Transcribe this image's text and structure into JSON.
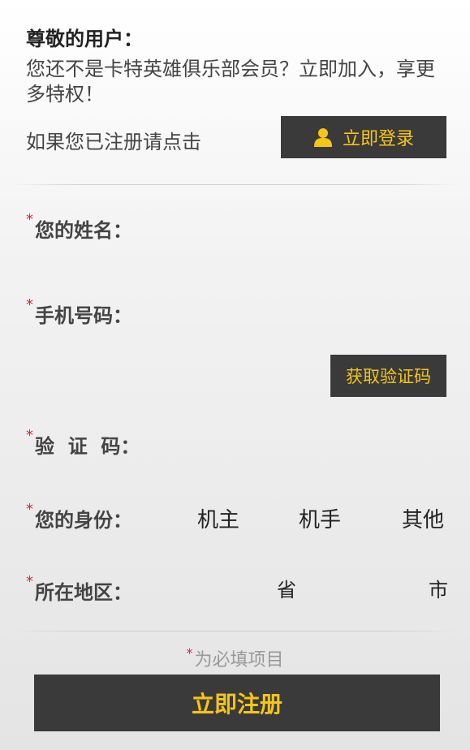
{
  "header": {
    "greeting": "尊敬的用户：",
    "intro": "您还不是卡特英雄俱乐部会员？立即加入，享更多特权！",
    "login_prompt": "如果您已注册请点击",
    "login_button": "立即登录",
    "login_icon": "user-icon"
  },
  "form": {
    "required_mark": "*",
    "name_label": "您的姓名：",
    "phone_label": "手机号码：",
    "get_code_button": "获取验证码",
    "code_label": "验  证  码：",
    "identity_label": "您的身份：",
    "identity_options": [
      "机主",
      "机手",
      "其他"
    ],
    "region_label": "所在地区：",
    "province_label": "省",
    "city_label": "市"
  },
  "footer": {
    "required_note": "为必填项目",
    "submit_button": "立即注册"
  },
  "colors": {
    "button_bg": "#3a3a3a",
    "button_text": "#f5c518",
    "required_star": "#dd2233"
  }
}
